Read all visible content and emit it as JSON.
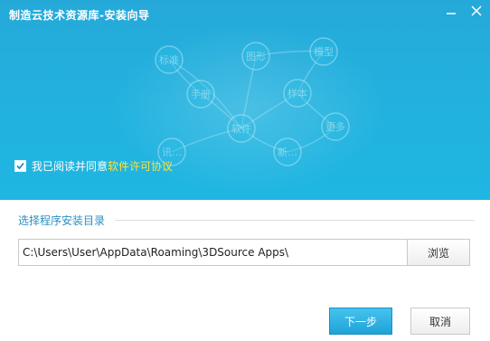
{
  "window": {
    "title": "制造云技术资源库-安装向导"
  },
  "banner": {
    "nodes": [
      "标准",
      "图形",
      "模型",
      "手册",
      "样本",
      "软件",
      "更多",
      "讯…",
      "新…"
    ]
  },
  "agreement": {
    "checked": true,
    "prefix": "我已阅读并同意",
    "link_text": "软件许可协议"
  },
  "install": {
    "section_title": "选择程序安装目录",
    "path": "C:\\Users\\User\\AppData\\Roaming\\3DSource Apps\\",
    "browse_label": "浏览"
  },
  "footer": {
    "next_label": "下一步",
    "cancel_label": "取消"
  },
  "colors": {
    "banner": "#22b2df",
    "accent": "#2b8fc0",
    "link": "#ffe23a"
  }
}
